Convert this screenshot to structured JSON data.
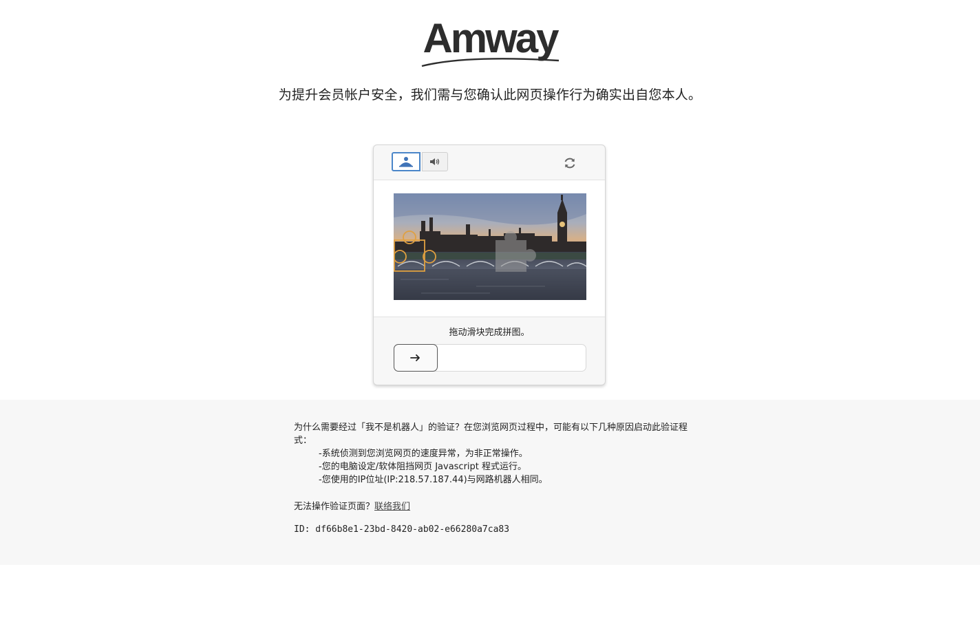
{
  "brand": {
    "name": "Amway"
  },
  "headline": "为提升会员帐户安全，我们需与您确认此网页操作行为确实出自您本人。",
  "captcha": {
    "instruction": "拖动滑块完成拼图。"
  },
  "info": {
    "why": "为什么需要经过「我不是机器人」的验证？在您浏览网页过程中，可能有以下几种原因启动此验证程式：",
    "reasons": [
      "-系统侦测到您浏览网页的速度异常，为非正常操作。",
      "-您的电脑设定/软体阻挡网页 Javascript 程式运行。",
      "-您使用的IP位址(IP:218.57.187.44)与网路机器人相同。"
    ],
    "contact_prefix": "无法操作验证页面？",
    "contact_link": "联络我们",
    "request_id": "ID: df66b8e1-23bd-8420-ab02-e66280a7ca83"
  },
  "colors": {
    "accent": "#4a86c9",
    "puzzle_outline": "#e0a040",
    "info_background": "#f7f7f7"
  }
}
